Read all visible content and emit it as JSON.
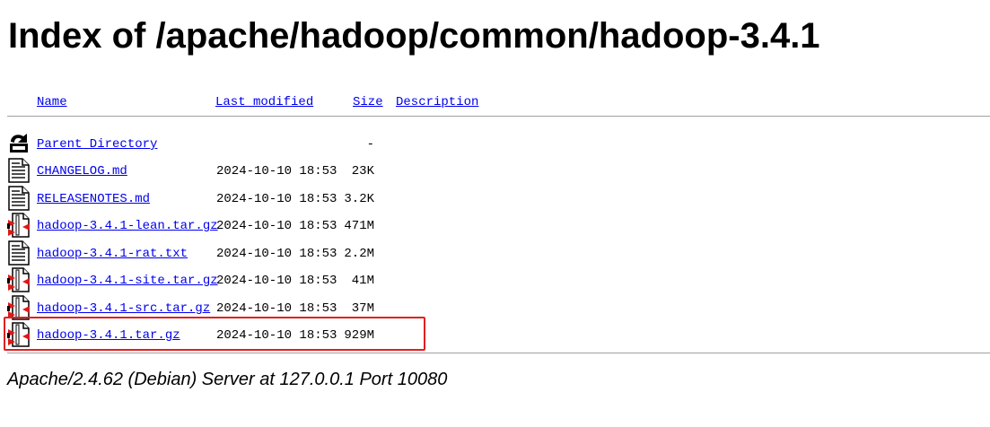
{
  "page": {
    "title": "Index of /apache/hadoop/common/hadoop-3.4.1"
  },
  "columns": {
    "name": "Name",
    "last_modified": "Last modified",
    "size": "Size",
    "description": "Description"
  },
  "rows": [
    {
      "icon": "back-icon",
      "name": "Parent Directory",
      "date": "",
      "size": "-"
    },
    {
      "icon": "text-file-icon",
      "name": "CHANGELOG.md",
      "date": "2024-10-10 18:53",
      "size": "23K"
    },
    {
      "icon": "text-file-icon",
      "name": "RELEASENOTES.md",
      "date": "2024-10-10 18:53",
      "size": "3.2K"
    },
    {
      "icon": "compressed-file-icon",
      "name": "hadoop-3.4.1-lean.tar.gz",
      "date": "2024-10-10 18:53",
      "size": "471M"
    },
    {
      "icon": "text-file-icon",
      "name": "hadoop-3.4.1-rat.txt",
      "date": "2024-10-10 18:53",
      "size": "2.2M"
    },
    {
      "icon": "compressed-file-icon",
      "name": "hadoop-3.4.1-site.tar.gz",
      "date": "2024-10-10 18:53",
      "size": "41M"
    },
    {
      "icon": "compressed-file-icon",
      "name": "hadoop-3.4.1-src.tar.gz",
      "date": "2024-10-10 18:53",
      "size": "37M"
    },
    {
      "icon": "compressed-file-icon",
      "name": "hadoop-3.4.1.tar.gz",
      "date": "2024-10-10 18:53",
      "size": "929M"
    }
  ],
  "footer": {
    "address": "Apache/2.4.62 (Debian) Server at 127.0.0.1 Port 10080"
  },
  "colors": {
    "link": "#0000ee",
    "highlight": "#e02020",
    "rule": "#a0a0a0"
  }
}
